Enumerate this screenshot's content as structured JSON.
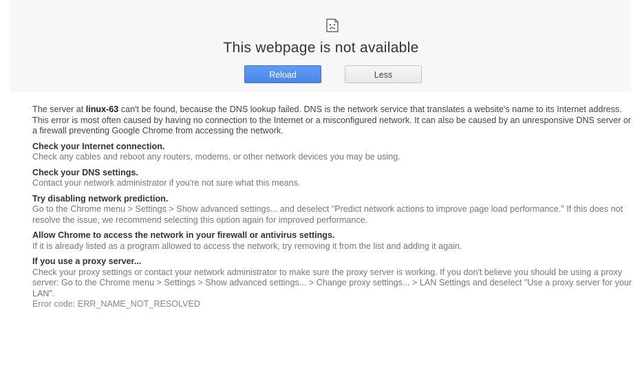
{
  "title": "This webpage is not available",
  "buttons": {
    "reload": "Reload",
    "less": "Less"
  },
  "intro": {
    "before": "The server at ",
    "host": "linux-63",
    "after": " can't be found, because the DNS lookup failed. DNS is the network service that translates a website's name to its Internet address. This error is most often caused by having no connection to the Internet or a misconfigured network. It can also be caused by an unresponsive DNS server or a firewall preventing Google Chrome from accessing the network."
  },
  "sections": [
    {
      "heading": "Check your Internet connection.",
      "body": "Check any cables and reboot any routers, modems, or other network devices you may be using."
    },
    {
      "heading": "Check your DNS settings.",
      "body": "Contact your network administrator if you're not sure what this means."
    },
    {
      "heading": "Try disabling network prediction.",
      "body": "Go to the Chrome menu > Settings > Show advanced settings... and deselect \"Predict network actions to improve page load performance.\" If this does not resolve the issue, we recommend selecting this option again for improved performance."
    },
    {
      "heading": "Allow Chrome to access the network in your firewall or antivirus settings.",
      "body": "If it is already listed as a program allowed to access the network, try removing it from the list and adding it again."
    },
    {
      "heading": "If you use a proxy server...",
      "body": "Check your proxy settings or contact your network administrator to make sure the proxy server is working. If you don't believe you should be using a proxy server: Go to the Chrome menu > Settings > Show advanced settings... > Change proxy settings... > LAN Settings and deselect \"Use a proxy server for your LAN\"."
    }
  ],
  "error_code": "Error code: ERR_NAME_NOT_RESOLVED",
  "icons": {
    "sad_page": "sad-page-icon"
  },
  "colors": {
    "reload_button": "#4a86ea",
    "top_panel": "#f7f7f7"
  }
}
